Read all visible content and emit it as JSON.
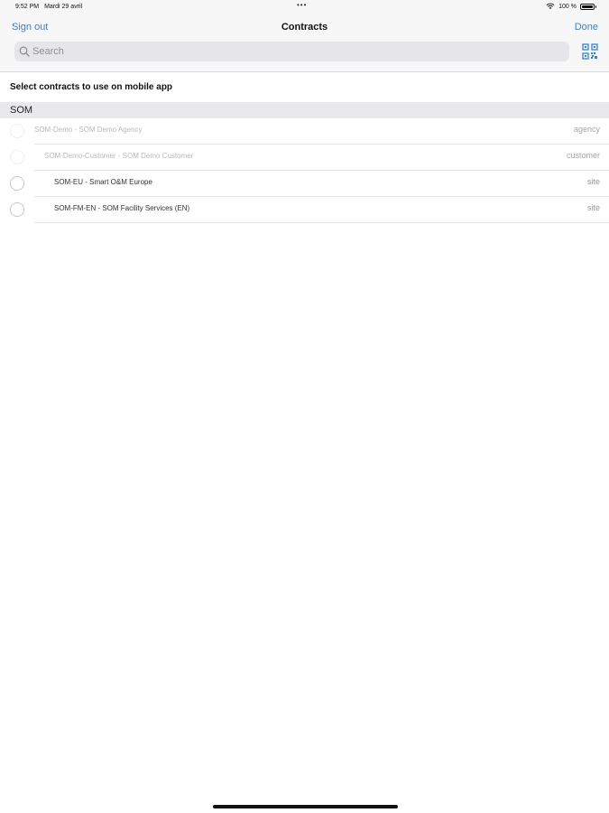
{
  "status_bar": {
    "time": "9:52 PM",
    "date": "Mardi 29 avril",
    "dots": "•••",
    "battery_percent": "100 %"
  },
  "nav": {
    "left_button": "Sign out",
    "title": "Contracts",
    "right_button": "Done"
  },
  "search": {
    "placeholder": "Search",
    "value": ""
  },
  "instruction": "Select contracts to use on mobile app",
  "section": {
    "title": "SOM",
    "contracts": [
      {
        "name": "SOM-Demo - SOM Demo Agency",
        "type": "agency",
        "enabled": false
      },
      {
        "name": "SOM-Demo-Customer - SOM Demo Customer",
        "type": "customer",
        "enabled": false
      },
      {
        "name": "SOM-EU - Smart O&M Europe",
        "type": "site",
        "enabled": true
      },
      {
        "name": "SOM-FM-EN - SOM Facility Services (EN)",
        "type": "site",
        "enabled": true
      }
    ]
  },
  "icons": {
    "search": "search-icon",
    "qr": "qr-code-icon",
    "wifi": "wifi-icon",
    "battery": "battery-icon"
  },
  "colors": {
    "accent": "#2f80ed",
    "chrome_background": "#f7f7f8",
    "section_background": "#e9e9ec"
  }
}
